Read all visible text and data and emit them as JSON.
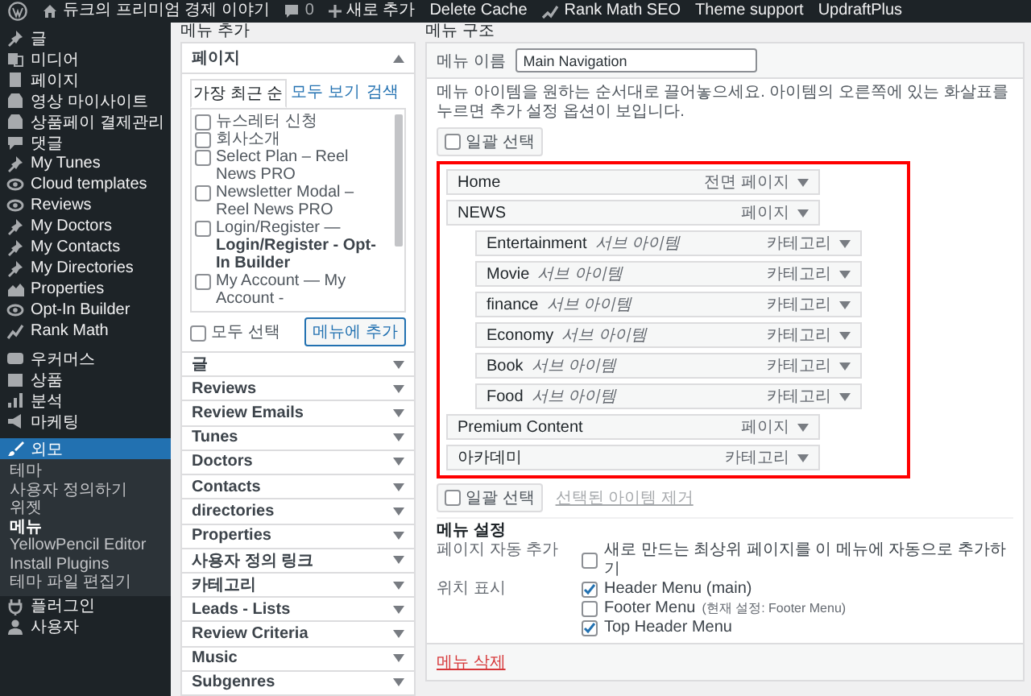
{
  "admin_bar": {
    "site_title": "듀크의 프리미엄 경제 이야기",
    "comments": "0",
    "new_label": "새로 추가",
    "links": [
      {
        "label": "Delete Cache",
        "kind": "text"
      },
      {
        "label": "Rank Math SEO",
        "kind": "icon"
      },
      {
        "label": "Theme support",
        "kind": "text"
      },
      {
        "label": "UpdraftPlus",
        "kind": "text"
      }
    ]
  },
  "sidebar": {
    "groups": [
      [
        {
          "label": "글",
          "selected": false
        },
        {
          "label": "미디어",
          "selected": false
        },
        {
          "label": "페이지",
          "selected": false
        },
        {
          "label": "영상 마이사이트",
          "selected": false
        },
        {
          "label": "상품페이 결제관리",
          "selected": false
        },
        {
          "label": "댓글",
          "selected": false
        },
        {
          "label": "My Tunes",
          "selected": false
        },
        {
          "label": "Cloud templates",
          "selected": false
        },
        {
          "label": "Reviews",
          "selected": false
        },
        {
          "label": "My Doctors",
          "selected": false
        },
        {
          "label": "My Contacts",
          "selected": false
        },
        {
          "label": "My Directories",
          "selected": false
        },
        {
          "label": "Properties",
          "selected": false
        },
        {
          "label": "Opt-In Builder",
          "selected": false
        },
        {
          "label": "Rank Math",
          "selected": false
        }
      ],
      [
        {
          "label": "우커머스",
          "selected": false
        },
        {
          "label": "상품",
          "selected": false
        },
        {
          "label": "분석",
          "selected": false
        },
        {
          "label": "마케팅",
          "selected": false
        }
      ],
      [
        {
          "label": "외모",
          "selected": true,
          "children": [
            {
              "label": "테마",
              "selected": false
            },
            {
              "label": "사용자 정의하기",
              "selected": false
            },
            {
              "label": "위젯",
              "selected": false
            },
            {
              "label": "메뉴",
              "selected": true
            },
            {
              "label": "YellowPencil Editor",
              "selected": false
            },
            {
              "label": "Install Plugins",
              "selected": false
            },
            {
              "label": "테마 파일 편집기",
              "selected": false
            }
          ]
        },
        {
          "label": "플러그인",
          "selected": false
        },
        {
          "label": "사용자",
          "selected": false
        }
      ]
    ]
  },
  "add_panel": {
    "heading": "메뉴 추가",
    "pages_box": {
      "title": "페이지",
      "expanded": true,
      "tabs": [
        {
          "label": "가장 최근 순",
          "selected": true
        },
        {
          "label": "모두 보기",
          "selected": false
        },
        {
          "label": "검색",
          "selected": false
        }
      ],
      "items": [
        {
          "label": "뉴스레터 신청",
          "checked": false
        },
        {
          "label": "회사소개",
          "checked": false
        },
        {
          "label": "Select Plan – Reel News PRO",
          "checked": false
        },
        {
          "label": "Newsletter Modal – Reel News PRO",
          "checked": false
        },
        {
          "label": "Login/Register — **Login/Register - Opt-In Builder**",
          "checked": false
        },
        {
          "label": "My Account — My Account -",
          "checked": false
        }
      ],
      "select_all": {
        "label": "모두 선택",
        "checked": false
      },
      "add_button": "메뉴에 추가"
    },
    "sections": [
      {
        "title": "글",
        "expanded": false
      },
      {
        "title": "Reviews",
        "expanded": false
      },
      {
        "title": "Review Emails",
        "expanded": false
      },
      {
        "title": "Tunes",
        "expanded": false
      },
      {
        "title": "Doctors",
        "expanded": false
      },
      {
        "title": "Contacts",
        "expanded": false
      },
      {
        "title": "directories",
        "expanded": false
      },
      {
        "title": "Properties",
        "expanded": false
      },
      {
        "title": "사용자 정의 링크",
        "expanded": false
      },
      {
        "title": "카테고리",
        "expanded": false
      },
      {
        "title": "Leads - Lists",
        "expanded": false
      },
      {
        "title": "Review Criteria",
        "expanded": false
      },
      {
        "title": "Music",
        "expanded": false
      },
      {
        "title": "Subgenres",
        "expanded": false
      }
    ]
  },
  "structure_panel": {
    "heading": "메뉴 구조",
    "menu_name": {
      "label": "메뉴 이름",
      "value": "Main Navigation"
    },
    "instructions": "메뉴 아이템을 원하는 순서대로 끌어놓으세요. 아이템의 오른쪽에 있는 화살표를 누르면 추가 설정 옵션이 보입니다.",
    "bulk_select_top": {
      "label": "일괄 선택",
      "checked": false
    },
    "highlighted": true,
    "items": [
      {
        "title": "Home",
        "type": "전면 페이지"
      },
      {
        "title": "NEWS",
        "type": "페이지",
        "children": [
          {
            "title": "Entertainment",
            "sub_label": "서브 아이템",
            "type": "카테고리"
          },
          {
            "title": "Movie",
            "sub_label": "서브 아이템",
            "type": "카테고리"
          },
          {
            "title": "finance",
            "sub_label": "서브 아이템",
            "type": "카테고리"
          },
          {
            "title": "Economy",
            "sub_label": "서브 아이템",
            "type": "카테고리"
          },
          {
            "title": "Book",
            "sub_label": "서브 아이템",
            "type": "카테고리"
          },
          {
            "title": "Food",
            "sub_label": "서브 아이템",
            "type": "카테고리"
          }
        ]
      },
      {
        "title": "Premium Content",
        "type": "페이지"
      },
      {
        "title": "아카데미",
        "type": "카테고리"
      }
    ],
    "bulk_select_bottom": {
      "label": "일괄 선택",
      "checked": false
    },
    "remove_selected": "선택된 아이템 제거",
    "settings": {
      "title": "메뉴 설정",
      "auto_add": {
        "label": "페이지 자동 추가",
        "options": [
          {
            "label": "새로 만드는 최상위 페이지를 이 메뉴에 자동으로 추가하기",
            "checked": false
          }
        ]
      },
      "locations": {
        "label": "위치 표시",
        "options": [
          {
            "label": "Header Menu (main)",
            "checked": true
          },
          {
            "label": "Footer Menu",
            "note": "(현재 설정: Footer Menu)",
            "checked": false
          },
          {
            "label": "Top Header Menu",
            "checked": true
          }
        ]
      }
    },
    "delete_link": "메뉴 삭제"
  }
}
